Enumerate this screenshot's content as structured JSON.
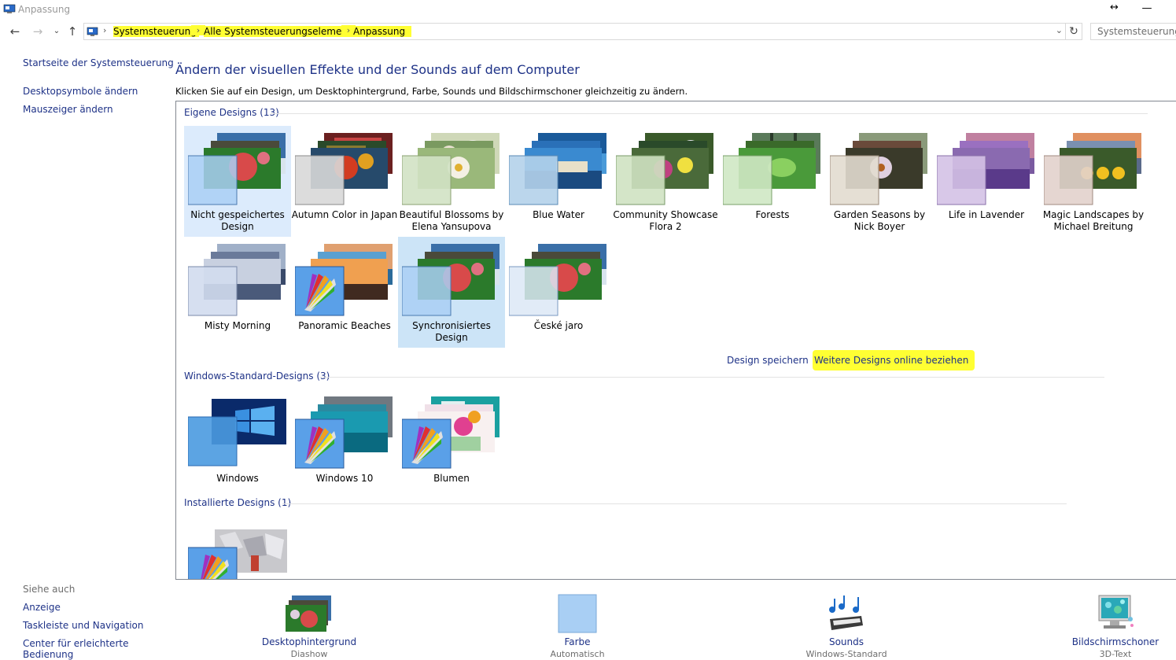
{
  "window": {
    "title": "Anpassung"
  },
  "address": {
    "crumbs": [
      "Systemsteuerung",
      "Alle Systemsteuerungselemente",
      "Anpassung"
    ],
    "search_placeholder": "Systemsteuerung d"
  },
  "sidebar": {
    "home": "Startseite der Systemsteuerung",
    "links": [
      "Desktopsymbole ändern",
      "Mauszeiger ändern"
    ],
    "see_also_title": "Siehe auch",
    "see_also": [
      "Anzeige",
      "Taskleiste und Navigation",
      "Center für erleichterte Bedienung"
    ]
  },
  "main": {
    "heading": "Ändern der visuellen Effekte und der Sounds auf dem Computer",
    "subtext": "Klicken Sie auf ein Design, um Desktophintergrund, Farbe, Sounds und Bildschirmschoner gleichzeitig zu ändern.",
    "groups": {
      "own": {
        "title": "Eigene Designs (13)",
        "items": [
          "Nicht gespeichertes Design",
          "Autumn Color in Japan",
          "Beautiful Blossoms by Elena Yansupova",
          "Blue Water",
          "Community Showcase Flora 2",
          "Forests",
          "Garden Seasons by Nick Boyer",
          "Life in Lavender",
          "Magic Landscapes by Michael Breitung",
          "Misty Morning",
          "Panoramic Beaches",
          "Synchronisiertes Design",
          "České jaro"
        ]
      },
      "standard": {
        "title": "Windows-Standard-Designs (3)",
        "items": [
          "Windows",
          "Windows 10",
          "Blumen"
        ]
      },
      "installed": {
        "title": "Installierte Designs (1)"
      }
    },
    "save_design": "Design speichern",
    "more_online": "Weitere Designs online beziehen"
  },
  "bottom": [
    {
      "label": "Desktophintergrund",
      "sub": "Diashow"
    },
    {
      "label": "Farbe",
      "sub": "Automatisch"
    },
    {
      "label": "Sounds",
      "sub": "Windows-Standard"
    },
    {
      "label": "Bildschirmschoner",
      "sub": "3D-Text"
    }
  ],
  "colors": {
    "link": "#1e3287",
    "highlight": "#ffff33",
    "selected_tile": "#dcebfc"
  }
}
